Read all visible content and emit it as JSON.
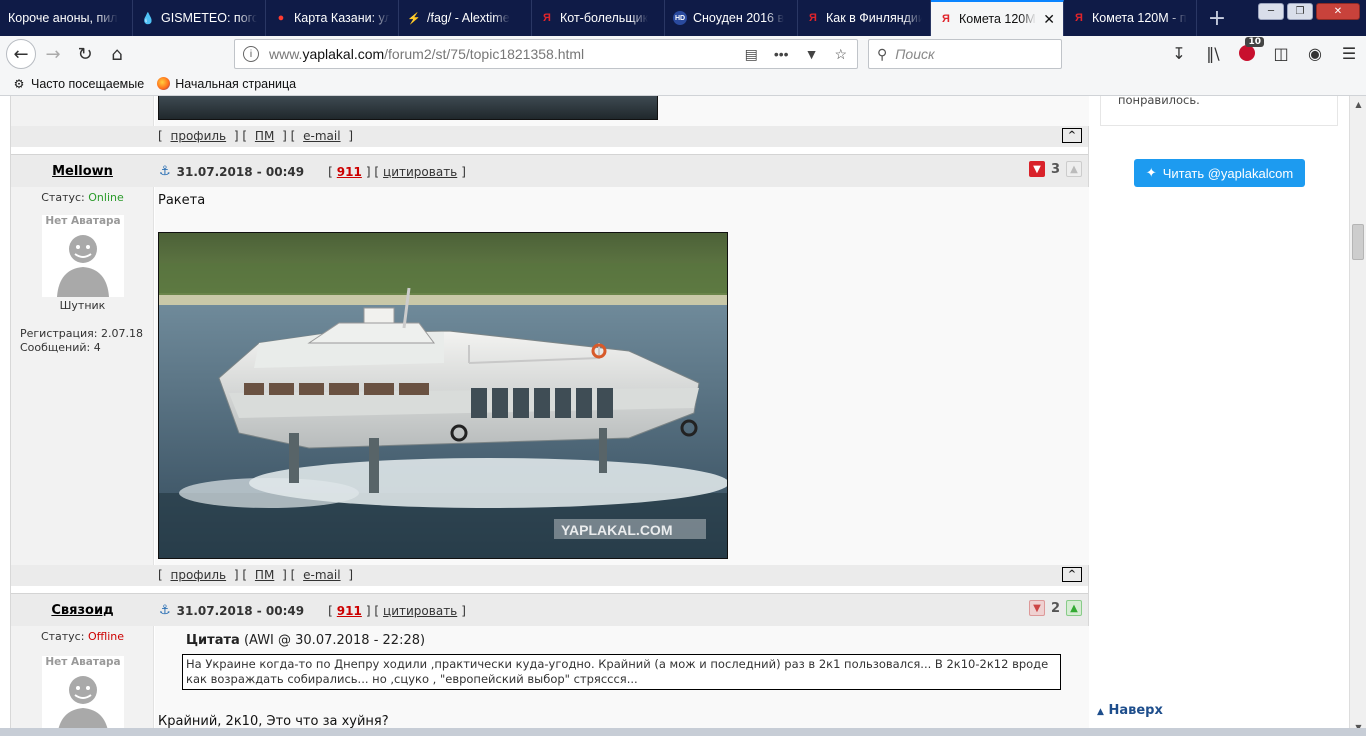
{
  "tabs": [
    {
      "title": "Короче аноны, пил",
      "icon": ""
    },
    {
      "title": "GISMETEO: погода",
      "icon": "drop-icon"
    },
    {
      "title": "Карта Казани: ул",
      "icon": "map-pin-icon"
    },
    {
      "title": "/fag/ - Alextime",
      "icon": "lightning-icon"
    },
    {
      "title": "Кот-болельщик",
      "icon": "yaplakal-icon"
    },
    {
      "title": "Сноуден 2016 в",
      "icon": "hd-icon"
    },
    {
      "title": "Как в Финляндии",
      "icon": "yaplakal-icon"
    },
    {
      "title": "Комета 120М",
      "icon": "yaplakal-icon",
      "active": true
    },
    {
      "title": "Комета 120М - п",
      "icon": "yaplakal-icon"
    }
  ],
  "url": {
    "prefix": "www.",
    "domain": "yaplakal.com",
    "path": "/forum2/st/75/topic1821358.html"
  },
  "search_placeholder": "Поиск",
  "toolbar_badge": "10",
  "bookmarks": [
    {
      "label": "Часто посещаемые",
      "icon": "gear-icon"
    },
    {
      "label": "Начальная страница",
      "icon": "firefox-icon"
    }
  ],
  "footer_links": {
    "profile": "профиль",
    "pm": "ПМ",
    "email": "e-mail",
    "top": "^"
  },
  "posts": [
    {
      "username": "Mellown",
      "date": "31.07.2018 - 00:49",
      "rep": "911",
      "quote_label": "цитировать",
      "status_label": "Статус:",
      "status": "Online",
      "no_avatar": "Нет Аватара",
      "rank": "Шутник",
      "registration": "Регистрация: 2.07.18",
      "messages": "Сообщений: 4",
      "votes": "3",
      "text": "Ракета",
      "watermark": "YAPLAKAL.COM"
    },
    {
      "username": "Связоид",
      "date": "31.07.2018 - 00:49",
      "rep": "911",
      "quote_label": "цитировать",
      "status_label": "Статус:",
      "status": "Offline",
      "no_avatar": "Нет Аватара",
      "votes": "2",
      "quote_title": "Цитата",
      "quote_author": "(AWI @ 30.07.2018 - 22:28)",
      "quote_text": "На Украине когда-то по Днепру ходили ,практически куда-угодно. Крайний (а мож и последний) раз в 2к1 пользовался... В 2к10-2к12 вроде как возраждать собирались... но ,сцуко , \"европейский выбор\" стряссся...",
      "text": "Крайний, 2к10, Это что за хуйня?"
    }
  ],
  "sidebar": {
    "box_text": "понравилось.",
    "twitter_button": "Читать @yaplakalcom",
    "go_top": "Наверх"
  },
  "colors": {
    "tabbar": "#0f1b47",
    "twitter": "#1d9bf0",
    "online": "#2b9b2b",
    "offline": "#cc0000",
    "rep": "#cc0000"
  }
}
